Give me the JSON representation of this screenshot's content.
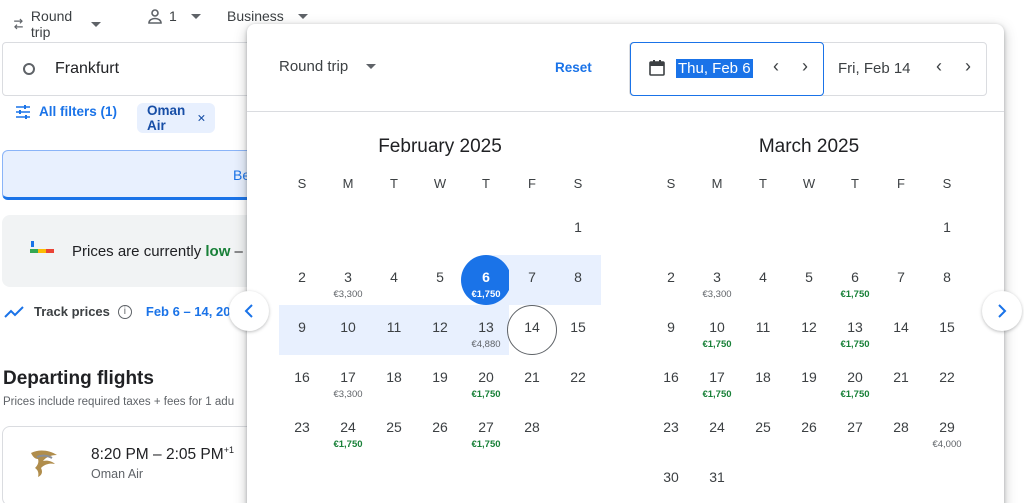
{
  "topbar": {
    "trip_type": "Round trip",
    "passengers": "1",
    "cabin": "Business"
  },
  "search": {
    "origin": "Frankfurt"
  },
  "filters": {
    "all_filters": "All filters (1)",
    "chip": "Oman Air"
  },
  "best_tab": {
    "label": "Be"
  },
  "price_insight": {
    "prefix": "Prices are currently ",
    "level": "low",
    "suffix": " –"
  },
  "track": {
    "label": "Track prices",
    "dates": "Feb 6 – 14, 20"
  },
  "departing": {
    "title": "Departing flights",
    "subtitle": "Prices include required taxes + fees for 1 adu"
  },
  "flight": {
    "times": "8:20 PM – 2:05 PM",
    "day_offset": "+1",
    "airline": "Oman Air"
  },
  "picker": {
    "trip_type": "Round trip",
    "reset": "Reset",
    "departure": "Thu, Feb 6",
    "return": "Fri, Feb 14",
    "weekdays": [
      "S",
      "M",
      "T",
      "W",
      "T",
      "F",
      "S"
    ],
    "months": [
      {
        "title": "February 2025",
        "days": [
          {
            "d": "",
            "p": ""
          },
          {
            "d": "",
            "p": ""
          },
          {
            "d": "",
            "p": ""
          },
          {
            "d": "",
            "p": ""
          },
          {
            "d": "",
            "p": ""
          },
          {
            "d": "",
            "p": ""
          },
          {
            "d": "1",
            "p": ""
          },
          {
            "d": "2",
            "p": ""
          },
          {
            "d": "3",
            "p": "€3,300"
          },
          {
            "d": "4",
            "p": ""
          },
          {
            "d": "5",
            "p": ""
          },
          {
            "d": "6",
            "p": "€1,750",
            "g": true,
            "state": "start"
          },
          {
            "d": "7",
            "p": "",
            "state": "range"
          },
          {
            "d": "8",
            "p": "",
            "state": "range"
          },
          {
            "d": "9",
            "p": "",
            "state": "range"
          },
          {
            "d": "10",
            "p": "",
            "state": "range"
          },
          {
            "d": "11",
            "p": "",
            "state": "range"
          },
          {
            "d": "12",
            "p": "",
            "state": "range"
          },
          {
            "d": "13",
            "p": "€4,880",
            "state": "range"
          },
          {
            "d": "14",
            "p": "",
            "state": "end"
          },
          {
            "d": "15",
            "p": ""
          },
          {
            "d": "16",
            "p": ""
          },
          {
            "d": "17",
            "p": "€3,300"
          },
          {
            "d": "18",
            "p": ""
          },
          {
            "d": "19",
            "p": ""
          },
          {
            "d": "20",
            "p": "€1,750",
            "g": true
          },
          {
            "d": "21",
            "p": ""
          },
          {
            "d": "22",
            "p": ""
          },
          {
            "d": "23",
            "p": ""
          },
          {
            "d": "24",
            "p": "€1,750",
            "g": true
          },
          {
            "d": "25",
            "p": ""
          },
          {
            "d": "26",
            "p": ""
          },
          {
            "d": "27",
            "p": "€1,750",
            "g": true
          },
          {
            "d": "28",
            "p": ""
          },
          {
            "d": "",
            "p": ""
          }
        ]
      },
      {
        "title": "March 2025",
        "days": [
          {
            "d": "",
            "p": ""
          },
          {
            "d": "",
            "p": ""
          },
          {
            "d": "",
            "p": ""
          },
          {
            "d": "",
            "p": ""
          },
          {
            "d": "",
            "p": ""
          },
          {
            "d": "",
            "p": ""
          },
          {
            "d": "1",
            "p": ""
          },
          {
            "d": "2",
            "p": ""
          },
          {
            "d": "3",
            "p": "€3,300"
          },
          {
            "d": "4",
            "p": ""
          },
          {
            "d": "5",
            "p": ""
          },
          {
            "d": "6",
            "p": "€1,750",
            "g": true
          },
          {
            "d": "7",
            "p": ""
          },
          {
            "d": "8",
            "p": ""
          },
          {
            "d": "9",
            "p": ""
          },
          {
            "d": "10",
            "p": "€1,750",
            "g": true
          },
          {
            "d": "11",
            "p": ""
          },
          {
            "d": "12",
            "p": ""
          },
          {
            "d": "13",
            "p": "€1,750",
            "g": true
          },
          {
            "d": "14",
            "p": ""
          },
          {
            "d": "15",
            "p": ""
          },
          {
            "d": "16",
            "p": ""
          },
          {
            "d": "17",
            "p": "€1,750",
            "g": true
          },
          {
            "d": "18",
            "p": ""
          },
          {
            "d": "19",
            "p": ""
          },
          {
            "d": "20",
            "p": "€1,750",
            "g": true
          },
          {
            "d": "21",
            "p": ""
          },
          {
            "d": "22",
            "p": ""
          },
          {
            "d": "23",
            "p": ""
          },
          {
            "d": "24",
            "p": ""
          },
          {
            "d": "25",
            "p": ""
          },
          {
            "d": "26",
            "p": ""
          },
          {
            "d": "27",
            "p": ""
          },
          {
            "d": "28",
            "p": ""
          },
          {
            "d": "29",
            "p": "€4,000"
          },
          {
            "d": "30",
            "p": ""
          },
          {
            "d": "31",
            "p": ""
          }
        ]
      }
    ]
  }
}
